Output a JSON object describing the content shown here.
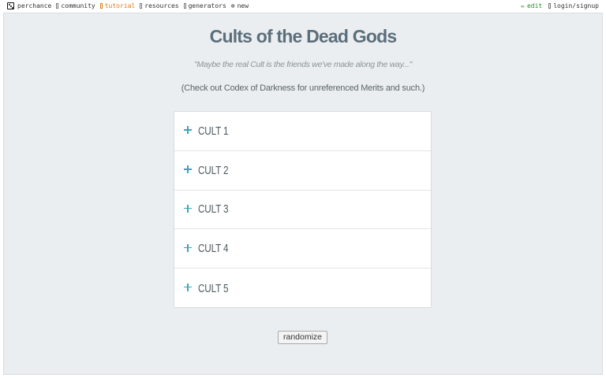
{
  "nav": {
    "left": [
      {
        "label": "perchance",
        "icon": "die-icon"
      },
      {
        "label": "community",
        "icon": "box-icon"
      },
      {
        "label": "tutorial",
        "icon": "box-icon",
        "color": "#e07b10"
      },
      {
        "label": "resources",
        "icon": "box-icon"
      },
      {
        "label": "generators",
        "icon": "box-icon"
      },
      {
        "label": "new",
        "icon": "circle-plus-icon"
      }
    ],
    "right": [
      {
        "label": "edit",
        "icon": "pencil-icon",
        "color": "#2a8a2a"
      },
      {
        "label": "login/signup",
        "icon": "box-icon"
      }
    ]
  },
  "page": {
    "title": "Cults of the Dead Gods",
    "quote": "\"Maybe the real Cult is the friends we've made along the way...\"",
    "note": "(Check out Codex of Darkness for unreferenced Merits and such.)"
  },
  "accordion": {
    "items": [
      "CULT 1",
      "CULT 2",
      "CULT 3",
      "CULT 4",
      "CULT 5"
    ],
    "accent": "#3aa6b9"
  },
  "actions": {
    "randomize_label": "randomize"
  }
}
